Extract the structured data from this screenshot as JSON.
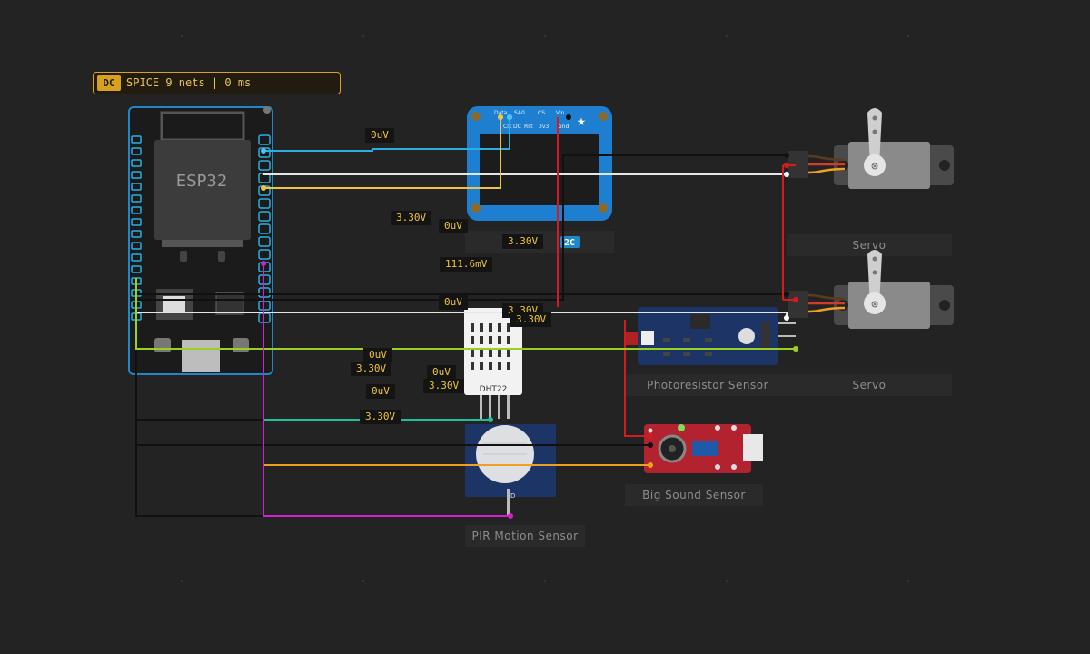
{
  "sim": {
    "mode": "DC",
    "status": "SPICE 9 nets | 0 ms"
  },
  "components": {
    "esp32": "ESP32",
    "servo1": "Servo",
    "servo2": "Servo",
    "photoresistor": "Photoresistor Sensor",
    "sound": "Big Sound Sensor",
    "pir": "PIR Motion Sensor",
    "dht": "DHT22",
    "oled_badge": "2C"
  },
  "oled_pins_top": [
    "Data",
    "SA0",
    "CS",
    "Vin"
  ],
  "oled_pins_bottom": [
    "Clk",
    "DC",
    "Rst",
    "3v3",
    "Gnd"
  ],
  "voltages": [
    "0uV",
    "3.30V",
    "0uV",
    "3.30V",
    "111.6mV",
    "0uV",
    "3.30V",
    "3.30V",
    "0uV",
    "3.30V",
    "0uV",
    "3.30V",
    "0uV",
    "3.30V"
  ],
  "colors": {
    "background": "#232323",
    "accent": "#d9a21c",
    "voltage_text": "#f0c43c",
    "esp32_border": "#1e88c8"
  }
}
